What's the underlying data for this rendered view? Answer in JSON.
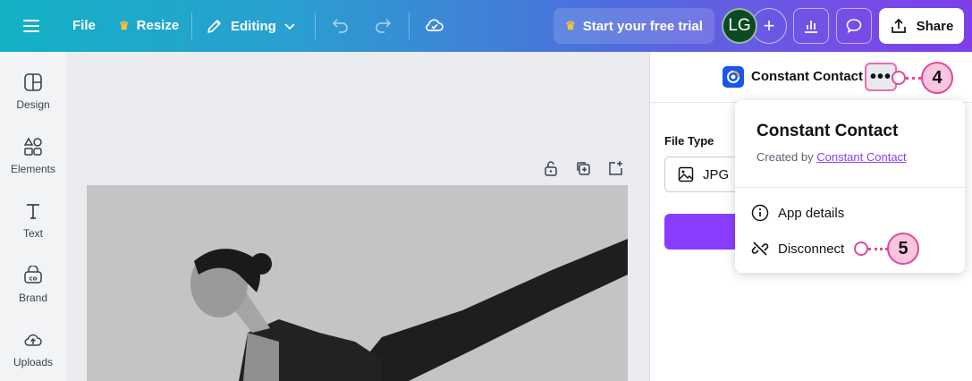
{
  "topbar": {
    "file_label": "File",
    "resize_label": "Resize",
    "editing_label": "Editing",
    "trial_label": "Start your free trial",
    "avatar_initials": "LG",
    "share_label": "Share",
    "gradient_start": "#13b1c6",
    "gradient_end": "#7d3fe8"
  },
  "sidebar": {
    "items": [
      {
        "label": "Design",
        "icon": "design-icon"
      },
      {
        "label": "Elements",
        "icon": "elements-icon"
      },
      {
        "label": "Text",
        "icon": "text-icon"
      },
      {
        "label": "Brand",
        "icon": "brand-icon"
      },
      {
        "label": "Uploads",
        "icon": "uploads-icon"
      }
    ]
  },
  "panel": {
    "app_name": "Constant Contact",
    "more_label": "•••",
    "file_type_label": "File Type",
    "file_type_value": "JPG"
  },
  "dropdown": {
    "title": "Constant Contact",
    "created_by_prefix": "Created by",
    "created_by_link": "Constant Contact",
    "items": [
      {
        "label": "App details",
        "icon": "info-icon"
      },
      {
        "label": "Disconnect",
        "icon": "disconnect-icon"
      }
    ]
  },
  "callouts": [
    {
      "number": "4"
    },
    {
      "number": "5"
    }
  ],
  "colors": {
    "accent_purple": "#8b3dff",
    "callout_pink": "#e2479a",
    "callout_fill": "#f9c6e0"
  }
}
